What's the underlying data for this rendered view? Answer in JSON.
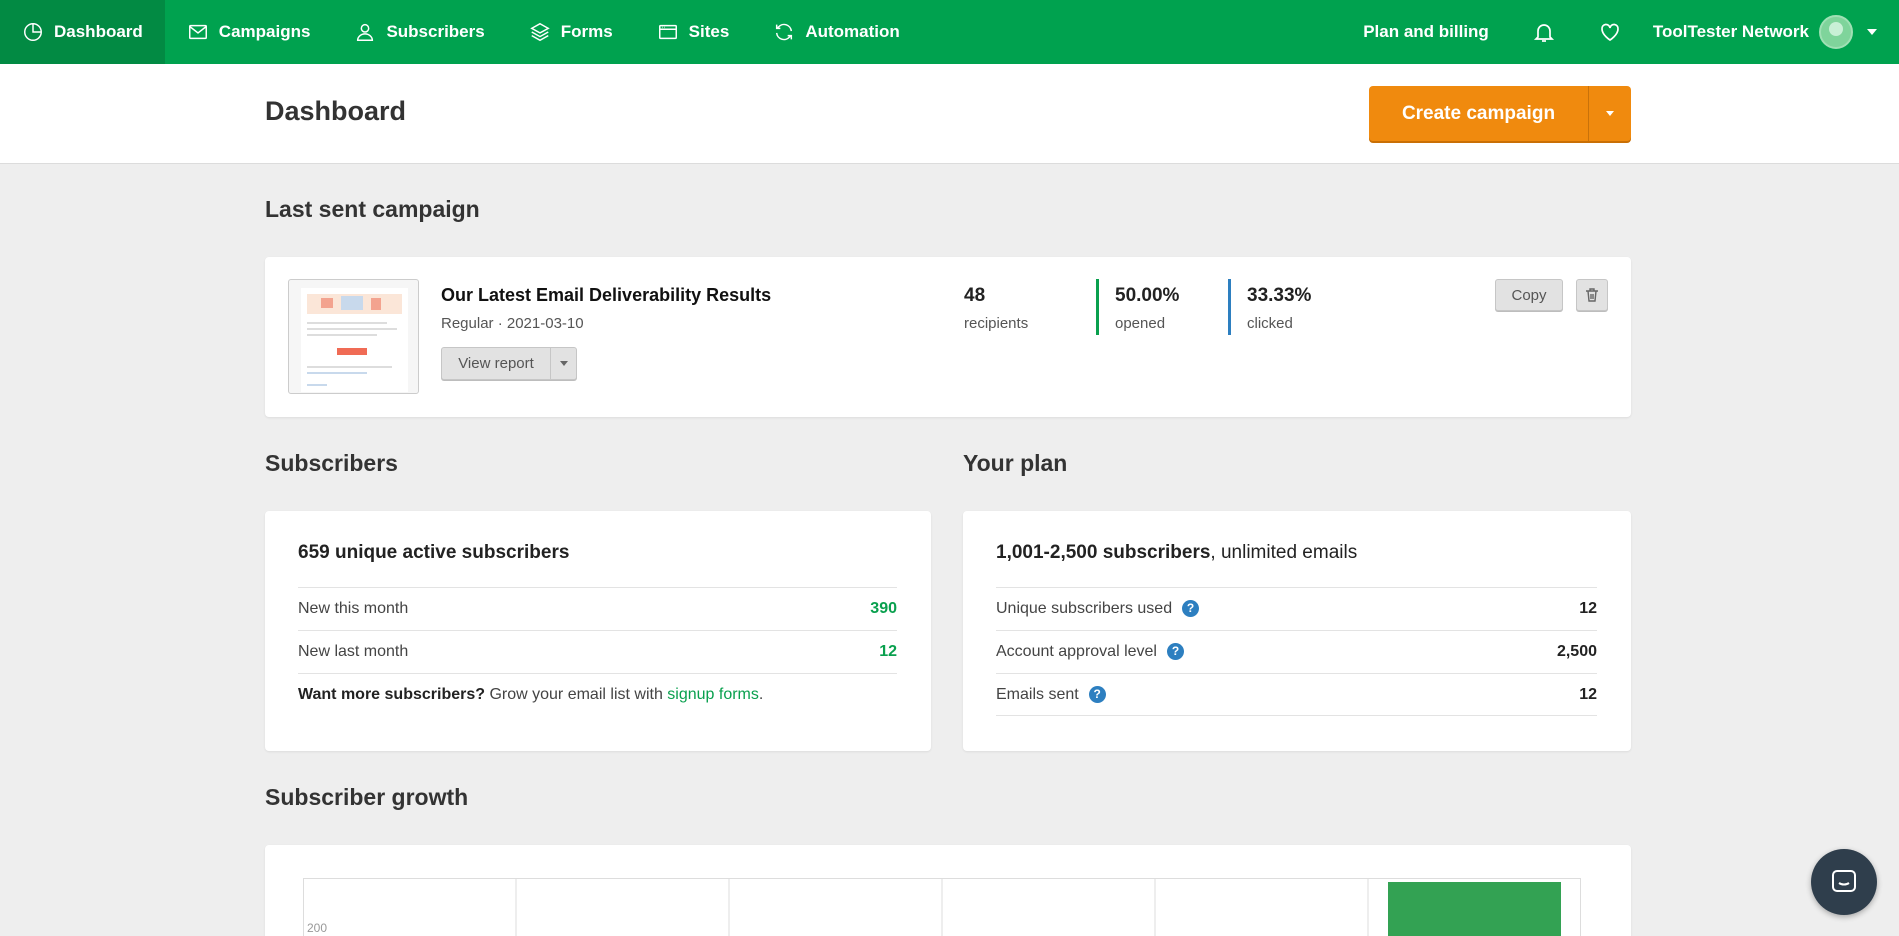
{
  "nav": {
    "items": [
      {
        "label": "Dashboard",
        "icon": "clock-pie-icon"
      },
      {
        "label": "Campaigns",
        "icon": "envelope-icon"
      },
      {
        "label": "Subscribers",
        "icon": "user-icon"
      },
      {
        "label": "Forms",
        "icon": "layers-icon"
      },
      {
        "label": "Sites",
        "icon": "browser-window-icon"
      },
      {
        "label": "Automation",
        "icon": "refresh-icon"
      }
    ],
    "plan_billing": "Plan and billing",
    "account_name": "ToolTester Network"
  },
  "header": {
    "title": "Dashboard",
    "create_campaign": "Create campaign"
  },
  "last_campaign": {
    "section_title": "Last sent campaign",
    "name": "Our Latest Email Deliverability Results",
    "meta": "Regular · 2021-03-10",
    "view_report": "View report",
    "copy": "Copy",
    "stats": [
      {
        "value": "48",
        "label": "recipients"
      },
      {
        "value": "50.00%",
        "label": "opened"
      },
      {
        "value": "33.33%",
        "label": "clicked"
      }
    ],
    "colors": {
      "opened": "#09a04e",
      "clicked": "#2d7fc0"
    }
  },
  "subscribers": {
    "section_title": "Subscribers",
    "heading": "659 unique active subscribers",
    "rows": [
      {
        "label": "New this month",
        "value": "390"
      },
      {
        "label": "New last month",
        "value": "12"
      }
    ],
    "note_bold": "Want more subscribers?",
    "note_text": " Grow your email list with ",
    "note_link": "signup forms",
    "note_end": "."
  },
  "plan": {
    "section_title": "Your plan",
    "heading_bold": "1,001-2,500 subscribers",
    "heading_rest": ", unlimited emails",
    "rows": [
      {
        "label": "Unique subscribers used",
        "value": "12"
      },
      {
        "label": "Account approval level",
        "value": "2,500"
      },
      {
        "label": "Emails sent",
        "value": "12"
      }
    ]
  },
  "growth": {
    "section_title": "Subscriber growth",
    "chart_data": {
      "type": "bar",
      "y_tick_labels": [
        "200"
      ],
      "visible_bars": 1
    }
  },
  "colors": {
    "brand_green": "#00a24f",
    "accent_orange": "#f08a0e",
    "bar_green": "#33a253"
  }
}
